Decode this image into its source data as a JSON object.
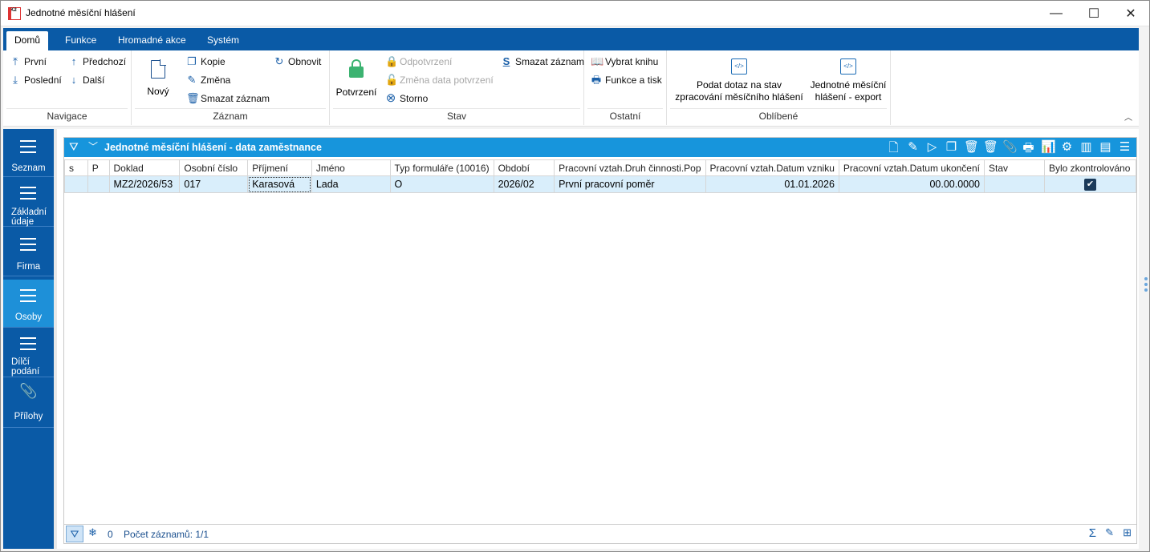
{
  "window": {
    "title": "Jednotné měsíční hlášení",
    "logo_text": "K2",
    "minimize": "—",
    "maximize": "☐",
    "close": "✕"
  },
  "tabs": [
    {
      "label": "Domů",
      "active": true
    },
    {
      "label": "Funkce"
    },
    {
      "label": "Hromadné akce"
    },
    {
      "label": "Systém"
    }
  ],
  "ribbon": {
    "navigace": {
      "label": "Navigace",
      "prvni": "První",
      "predchozi": "Předchozí",
      "posledni": "Poslední",
      "dalsi": "Další"
    },
    "zaznam": {
      "label": "Záznam",
      "novy": "Nový",
      "kopie": "Kopie",
      "zmena": "Změna",
      "smazat": "Smazat záznam",
      "obnovit": "Obnovit"
    },
    "stav": {
      "label": "Stav",
      "potvrzeni": "Potvrzení",
      "odpotvrzeni": "Odpotvrzení",
      "zmena_data": "Změna data potvrzení",
      "storno": "Storno",
      "smazat": "Smazat záznam"
    },
    "ostatni": {
      "label": "Ostatní",
      "vybrat_knihu": "Vybrat knihu",
      "funkce_tisk": "Funkce a tisk"
    },
    "oblibene": {
      "label": "Oblíbené",
      "podat_line1": "Podat dotaz na stav",
      "podat_line2": "zpracování měsíčního hlášení",
      "export_line1": "Jednotné měsíční",
      "export_line2": "hlášení - export"
    }
  },
  "sidebar": [
    {
      "label": "Seznam"
    },
    {
      "label1": "Základní",
      "label2": "údaje"
    },
    {
      "label": "Firma"
    },
    {
      "label": "Osoby",
      "active": true
    },
    {
      "label1": "Dílčí",
      "label2": "podání"
    },
    {
      "label": "Přílohy"
    }
  ],
  "panel": {
    "title": "Jednotné měsíční hlášení - data zaměstnance",
    "columns": [
      "s",
      "P",
      "Doklad",
      "Osobní číslo",
      "Příjmení",
      "Jméno",
      "Typ formuláře (10016)",
      "Období",
      "Pracovní vztah.Druh činnosti.Pop",
      "Pracovní vztah.Datum vzniku",
      "Pracovní vztah.Datum ukončení",
      "Stav",
      "Bylo zkontrolováno"
    ],
    "rows": [
      {
        "s": "",
        "p": "",
        "doklad": "MZ2/2026/53",
        "osobni_cislo": "017",
        "prijmeni": "Karasová",
        "jmeno": "Lada",
        "typ": "O",
        "obdobi": "2026/02",
        "druh": "První pracovní poměr",
        "vznik": "01.01.2026",
        "ukonceni": "00.00.0000",
        "stav": "",
        "zkontrolovano": "✔"
      }
    ],
    "footer": {
      "freeze_count": "0",
      "record_count": "Počet záznamů: 1/1"
    }
  },
  "colors": {
    "accent": "#0a5aa6",
    "header": "#1795dc",
    "selected_row": "#d9eefb"
  }
}
